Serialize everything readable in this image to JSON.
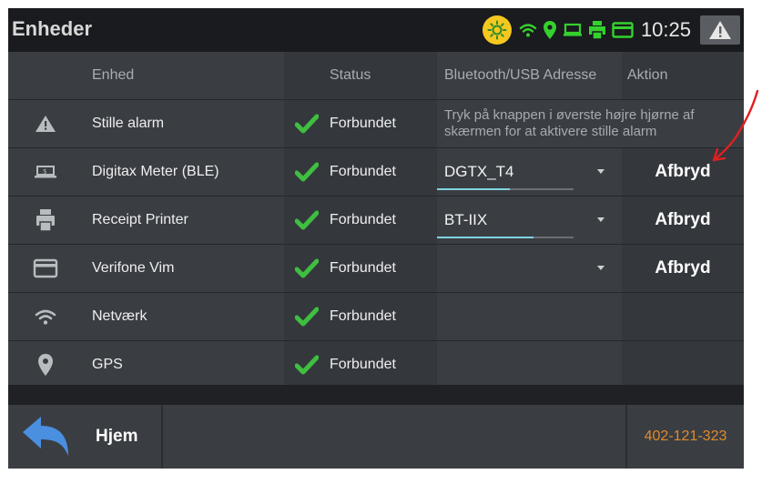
{
  "header": {
    "title": "Enheder",
    "time": "10:25",
    "icons": [
      "brightness-icon",
      "wifi-icon",
      "location-icon",
      "meter-icon",
      "printer-icon",
      "card-icon",
      "alert-icon"
    ]
  },
  "table": {
    "columns": [
      "Enhed",
      "Status",
      "Bluetooth/USB Adresse",
      "Aktion"
    ],
    "rows": [
      {
        "icon": "warning-icon",
        "name": "Stille alarm",
        "status": "Forbundet",
        "address_note": "Tryk på knappen i øverste højre hjørne af skærmen for at aktivere stille alarm"
      },
      {
        "icon": "meter-icon",
        "name": "Digitax Meter (BLE)",
        "status": "Forbundet",
        "address": "DGTX_T4",
        "action": "Afbryd"
      },
      {
        "icon": "printer-icon",
        "name": "Receipt Printer",
        "status": "Forbundet",
        "address": "BT-IIX",
        "action": "Afbryd"
      },
      {
        "icon": "card-icon",
        "name": "Verifone Vim",
        "status": "Forbundet",
        "address": "",
        "action": "Afbryd"
      },
      {
        "icon": "wifi-icon",
        "name": "Netværk",
        "status": "Forbundet"
      },
      {
        "icon": "location-icon",
        "name": "GPS",
        "status": "Forbundet"
      }
    ]
  },
  "footer": {
    "home_label": "Hjem",
    "serial": "402-121-323"
  },
  "colors": {
    "check": "#3fbf3f",
    "accent_line": "#7fd3e0",
    "serial": "#e08a2c",
    "annotation": "#e02020"
  }
}
